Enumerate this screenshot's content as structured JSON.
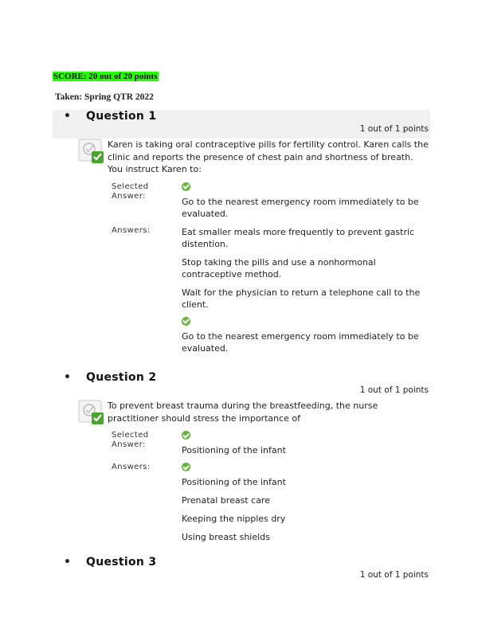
{
  "score": "SCORE: 20 out of 20 points",
  "taken": "Taken: Spring QTR 2022",
  "colors": {
    "score_highlight": "#22ff00",
    "check_green": "#6cb33f",
    "header_band": "#f0f0f0"
  },
  "labels": {
    "selected_answer": "Selected Answer:",
    "answers": "Answers:"
  },
  "questions": [
    {
      "title": "Question 1",
      "points": "1 out of 1 points",
      "text": "Karen is taking oral contraceptive pills for fertility control. Karen calls the clinic and reports the presence of chest pain and shortness of breath. You instruct Karen to:",
      "selected_answer": "Go to the nearest emergency room immediately to be evaluated.",
      "answers": [
        {
          "text": "Eat smaller meals more frequently to prevent gastric distention.",
          "correct": false
        },
        {
          "text": "Stop taking the pills and use a nonhormonal contraceptive method.",
          "correct": false
        },
        {
          "text": "Wait for the physician to return a telephone call to the client.",
          "correct": false
        },
        {
          "text": "Go to the nearest emergency room immediately to be evaluated.",
          "correct": true
        }
      ]
    },
    {
      "title": "Question 2",
      "points": "1 out of 1 points",
      "text": "To prevent breast trauma during the breastfeeding, the nurse practitioner should stress the importance of",
      "selected_answer": "Positioning of the infant",
      "answers": [
        {
          "text": "Positioning of the infant",
          "correct": true
        },
        {
          "text": "Prenatal breast care",
          "correct": false
        },
        {
          "text": "Keeping the nipples dry",
          "correct": false
        },
        {
          "text": "Using breast shields",
          "correct": false
        }
      ]
    },
    {
      "title": "Question 3",
      "points": "1 out of 1 points"
    }
  ]
}
